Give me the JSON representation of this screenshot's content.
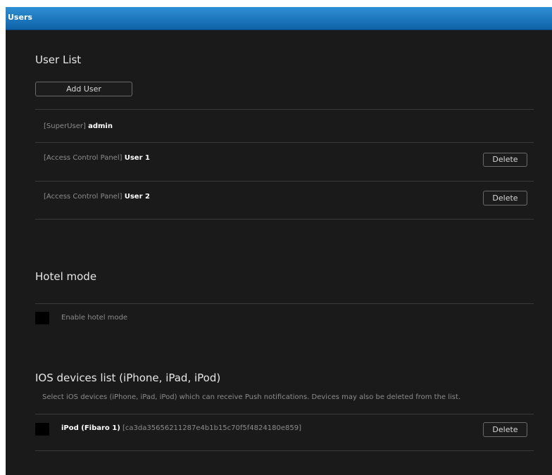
{
  "window": {
    "title": "Users"
  },
  "user_list": {
    "heading": "User List",
    "add_button": "Add User",
    "users": [
      {
        "role": "[SuperUser]",
        "name": "admin",
        "delete_label": ""
      },
      {
        "role": "[Access Control Panel]",
        "name": "User 1",
        "delete_label": "Delete"
      },
      {
        "role": "[Access Control Panel]",
        "name": "User 2",
        "delete_label": "Delete"
      }
    ]
  },
  "hotel_mode": {
    "heading": "Hotel mode",
    "checkbox_label": "Enable hotel mode",
    "checked": false
  },
  "ios_devices": {
    "heading": "IOS devices list (iPhone, iPad, iPod)",
    "description": "Select iOS devices (iPhone, iPad, iPod) which can receive Push notifications. Devices may also be deleted from the list.",
    "devices": [
      {
        "name": "iPod (Fibaro 1)",
        "id": "[ca3da35656211287e4b1b15c70f5f4824180e859]",
        "delete_label": "Delete",
        "checked": false
      }
    ]
  },
  "colors": {
    "title_bar": "#1a78c2",
    "panel_background": "#1a1a1a",
    "text_primary": "#ffffff",
    "text_secondary": "#8c8c8c"
  }
}
